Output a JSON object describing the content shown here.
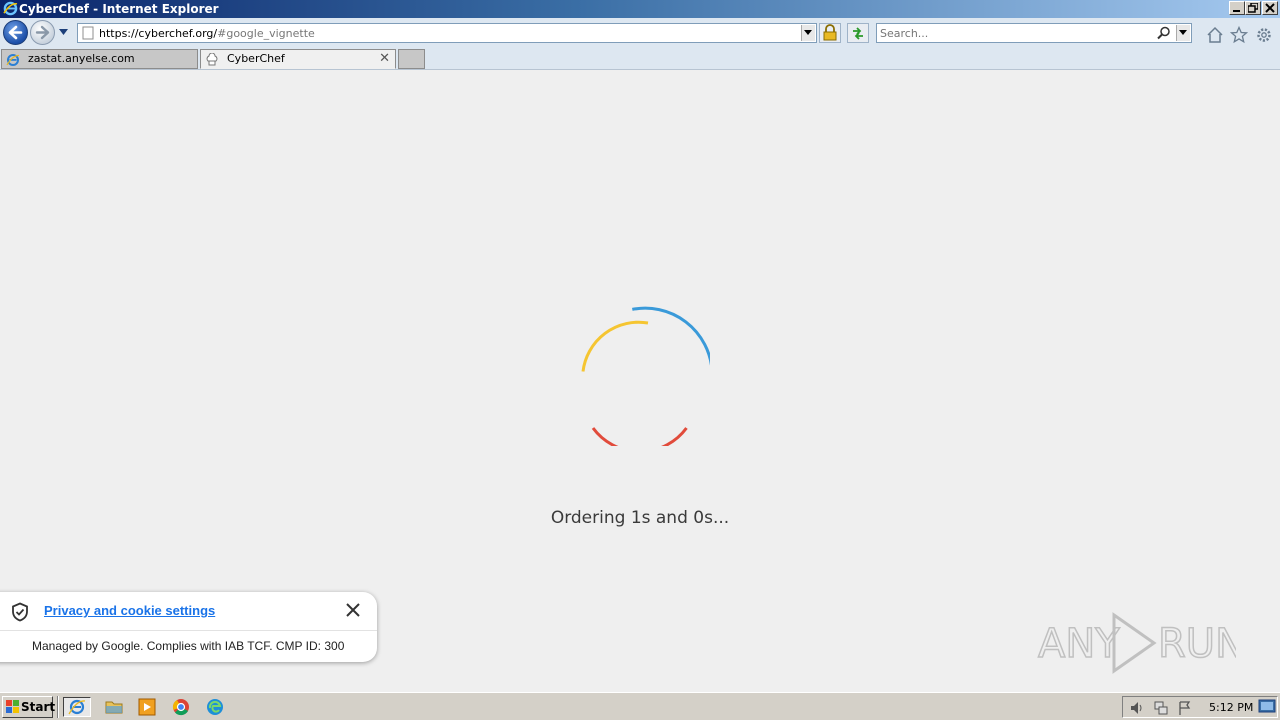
{
  "window": {
    "title": "CyberChef - Internet Explorer"
  },
  "addressbar": {
    "url_main": "https://cyberchef.org/",
    "url_fragment": "#google_vignette"
  },
  "searchbox": {
    "placeholder": "Search..."
  },
  "tabs": [
    {
      "label": "zastat.anyelse.com",
      "icon": "ie-icon",
      "active": false
    },
    {
      "label": "CyberChef",
      "icon": "chef-hat-icon",
      "active": true
    }
  ],
  "page": {
    "loading_text": "Ordering 1s and 0s...",
    "spinner_colors": {
      "outer": "#3a9ad9",
      "middle": "#f5c531",
      "inner": "#e14b3b"
    }
  },
  "cookie_banner": {
    "link_text": "Privacy and cookie settings",
    "note": "Managed by Google. Complies with IAB TCF. CMP ID: 300"
  },
  "watermark": {
    "text": "ANY RUN"
  },
  "taskbar": {
    "start_label": "Start",
    "clock": "5:12 PM"
  },
  "colors": {
    "titlebar_start": "#0a246a",
    "link": "#1a73e8"
  }
}
